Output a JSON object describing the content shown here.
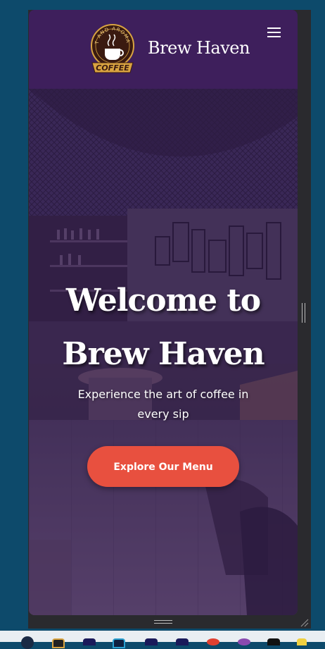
{
  "app": {
    "brand_name": "Brew Haven",
    "logo_text_top": "HOT AND AROMATIC",
    "logo_text_banner": "COFFEE",
    "menu_icon": "hamburger-icon"
  },
  "hero": {
    "title_line1": "Welcome to",
    "title_line2": "Brew Haven",
    "subtitle_line1": "Experience the art of coffee in",
    "subtitle_line2": "every sip",
    "cta_label": "Explore Our Menu"
  },
  "colors": {
    "navbar_bg": "#3e1f5c",
    "cta_bg": "#e8503f",
    "desktop_bg": "#0d4a6b",
    "overlay": "rgba(60,30,95,0.45)"
  },
  "taskbar": {
    "icons": [
      "app-icon-1",
      "app-icon-2",
      "app-icon-3",
      "app-icon-4",
      "app-icon-5",
      "app-icon-6",
      "app-icon-7",
      "app-icon-8",
      "app-icon-9",
      "app-icon-10",
      "app-icon-11"
    ]
  }
}
